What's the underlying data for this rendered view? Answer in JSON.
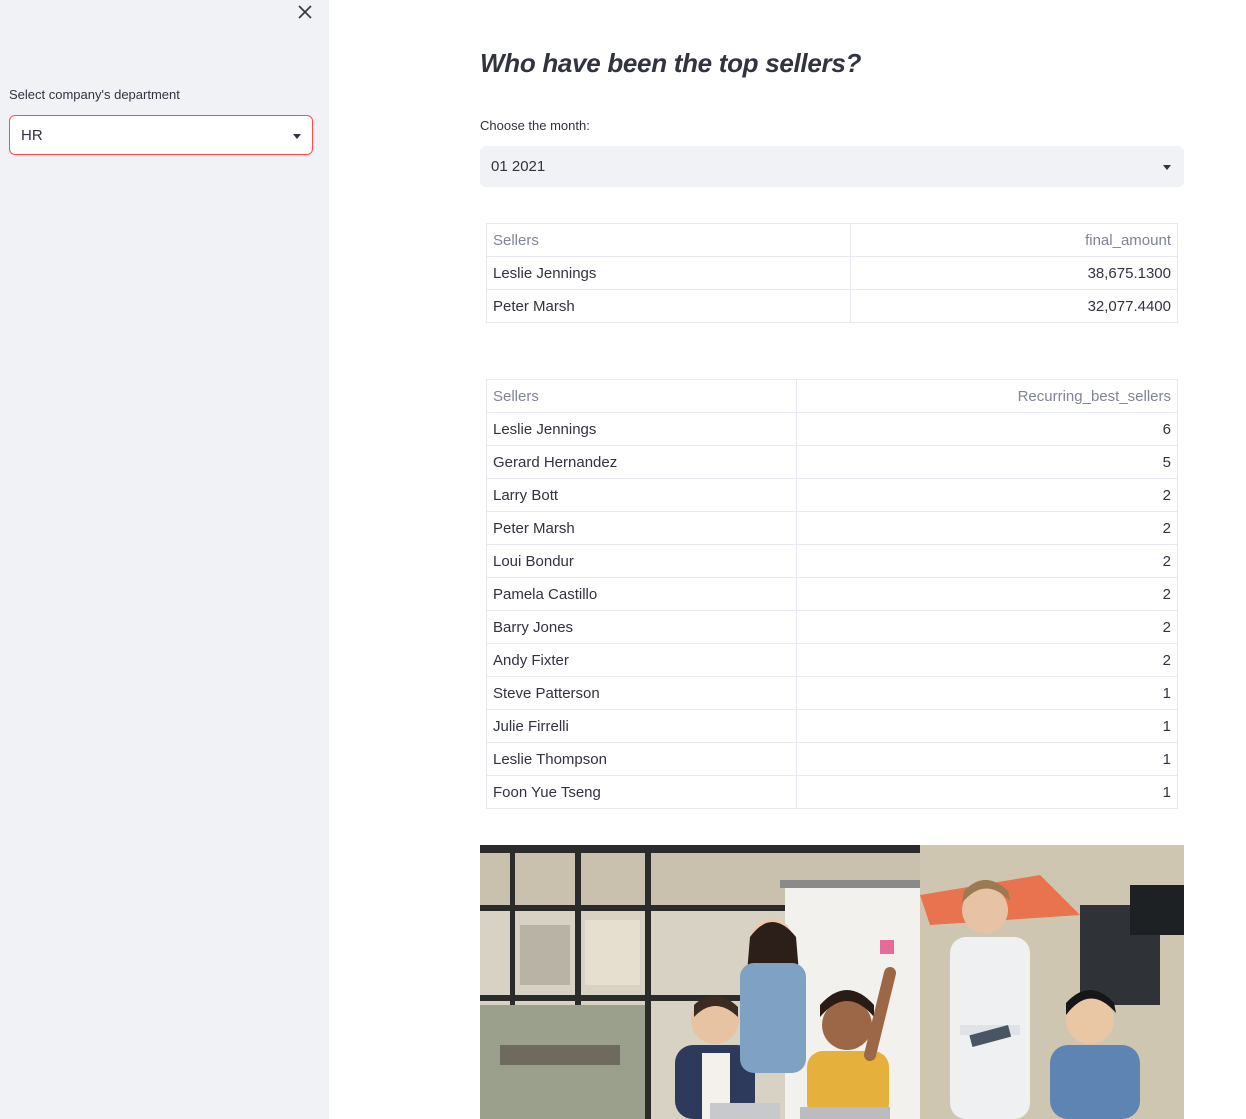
{
  "sidebar": {
    "department_label": "Select company's department",
    "department_value": "HR"
  },
  "main": {
    "title": "Who have been the top sellers?",
    "month_label": "Choose the month:",
    "month_value": "01 2021"
  },
  "table_amounts": {
    "headers": [
      "Sellers",
      "final_amount"
    ],
    "rows": [
      [
        "Leslie Jennings",
        "38,675.1300"
      ],
      [
        "Peter Marsh",
        "32,077.4400"
      ]
    ]
  },
  "table_recurring": {
    "headers": [
      "Sellers",
      "Recurring_best_sellers"
    ],
    "rows": [
      [
        "Leslie Jennings",
        "6"
      ],
      [
        "Gerard Hernandez",
        "5"
      ],
      [
        "Larry Bott",
        "2"
      ],
      [
        "Peter Marsh",
        "2"
      ],
      [
        "Loui Bondur",
        "2"
      ],
      [
        "Pamela Castillo",
        "2"
      ],
      [
        "Barry Jones",
        "2"
      ],
      [
        "Andy Fixter",
        "2"
      ],
      [
        "Steve Patterson",
        "1"
      ],
      [
        "Julie Firrelli",
        "1"
      ],
      [
        "Leslie Thompson",
        "1"
      ],
      [
        "Foon Yue Tseng",
        "1"
      ]
    ]
  },
  "colors": {
    "sidebar_bg": "#f0f2f6",
    "accent": "#ff4b4b",
    "text": "#31333f",
    "header_text": "#808495",
    "border": "#e6e9ef"
  },
  "icons": {
    "close": "close-icon",
    "caret": "caret-down-icon"
  }
}
